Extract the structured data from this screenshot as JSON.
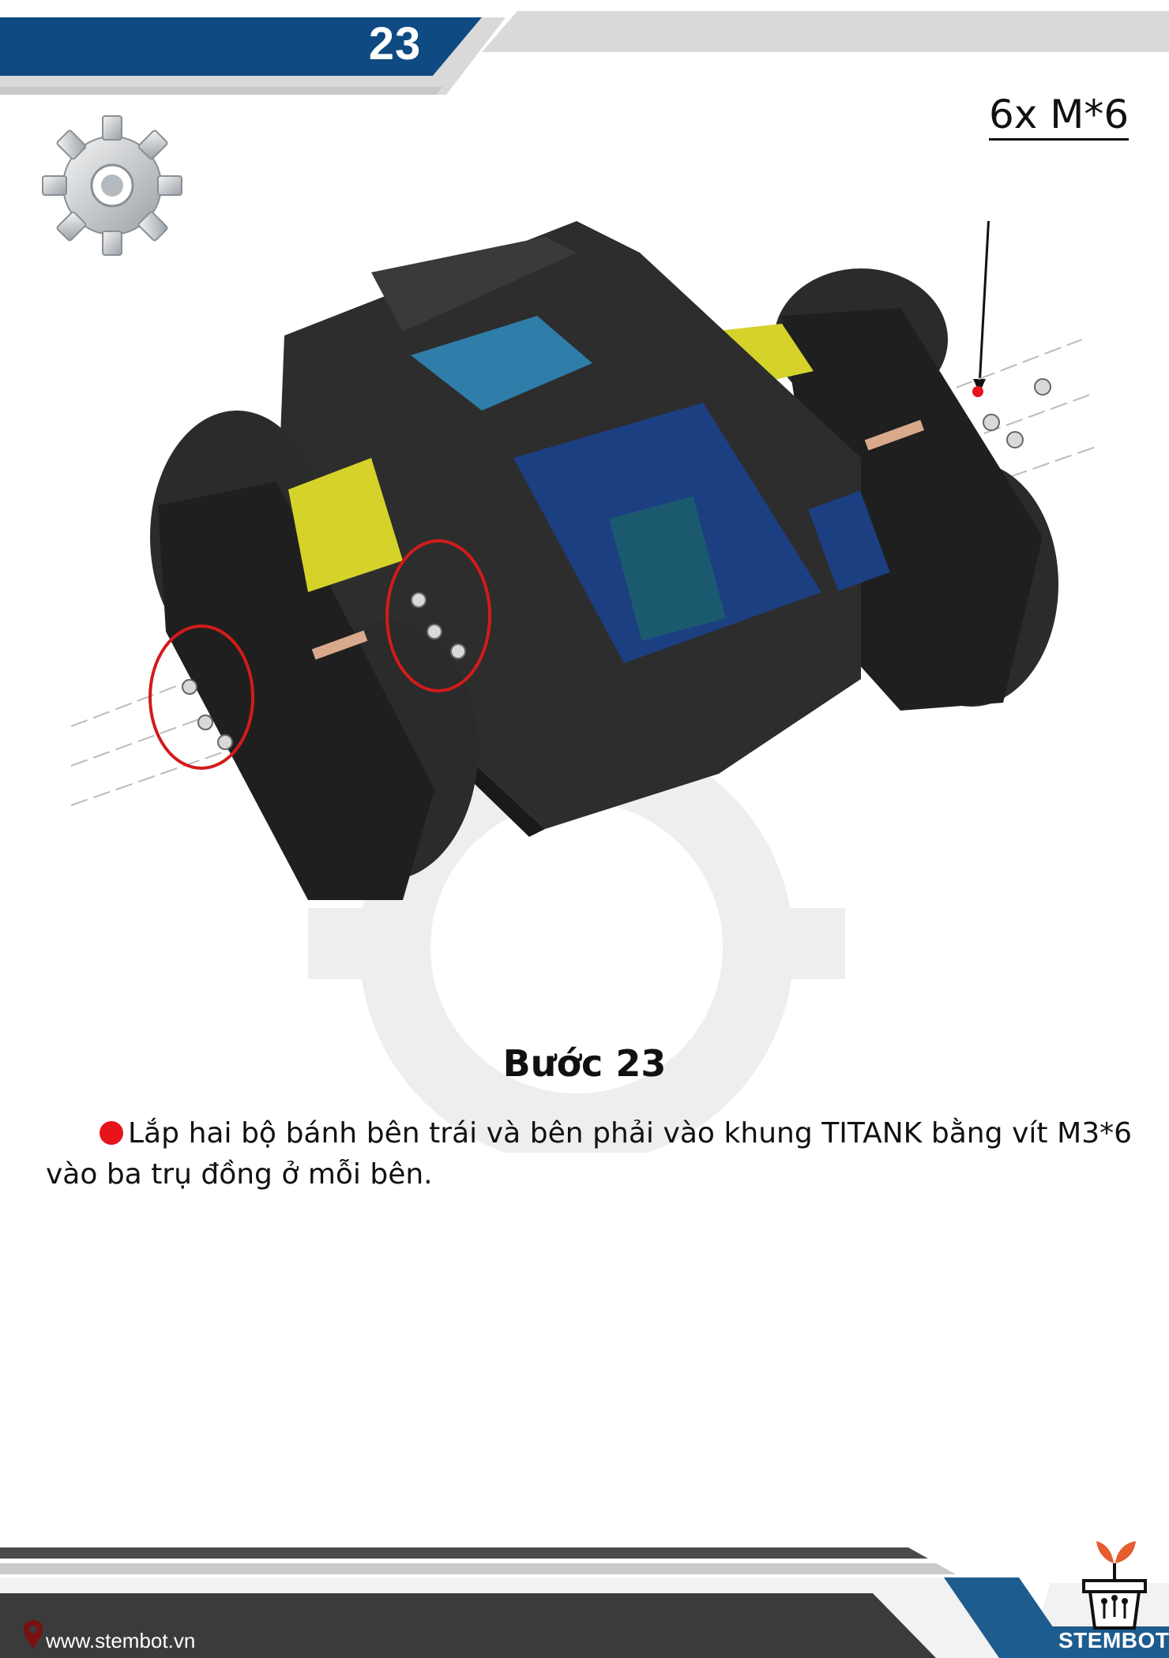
{
  "header": {
    "page_number": "23"
  },
  "callout": {
    "label": "6x M*6"
  },
  "step": {
    "title": "Bước 23",
    "instruction": "Lắp hai bộ bánh bên trái và bên phải vào khung TITANK bằng vít M3*6 vào ba trụ đồng ở mỗi bên."
  },
  "footer": {
    "website": "www.stembot.vn",
    "brand": "STEMBOT"
  },
  "colors": {
    "header_blue": "#0f4a82",
    "header_gray": "#d9d9d9",
    "footer_dark": "#3b3b3b",
    "bullet_red": "#e8141c"
  },
  "icons": [
    "gear-icon",
    "location-pin-icon",
    "plant-pot-logo-icon"
  ]
}
